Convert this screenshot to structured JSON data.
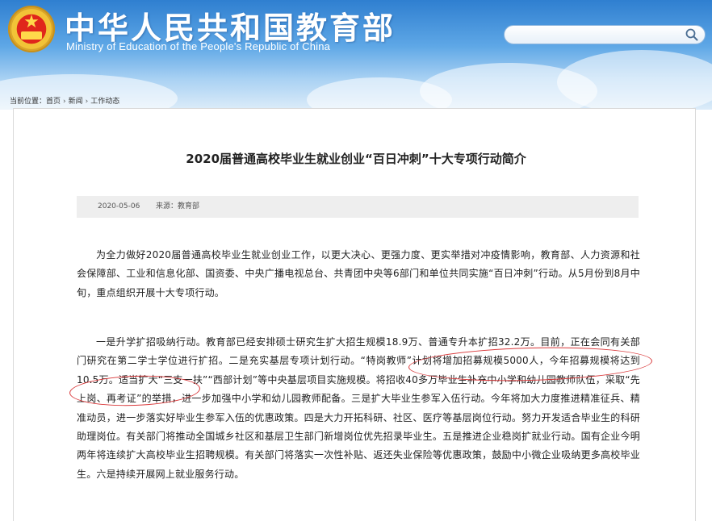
{
  "header": {
    "title": "中华人民共和国教育部",
    "subtitle": "Ministry of Education of the People's Republic of China",
    "search": {
      "value": "",
      "icon": "search-icon"
    },
    "emblem_icon": "national-emblem-icon"
  },
  "breadcrumb": {
    "prefix": "当前位置：",
    "items": [
      "首页",
      "新闻",
      "工作动态"
    ],
    "separator": "›"
  },
  "article": {
    "title": "2020届普通高校毕业生就业创业“百日冲刺”十大专项行动简介",
    "date": "2020-05-06",
    "source": "来源：教育部",
    "paragraphs": [
      "为全力做好2020届普通高校毕业生就业创业工作，以更大决心、更强力度、更实举措对冲疫情影响，教育部、人力资源和社会保障部、工业和信息化部、国资委、中央广播电视总台、共青团中央等6部门和单位共同实施“百日冲刺”行动。从5月份到8月中旬，重点组织开展十大专项行动。",
      "一是升学扩招吸纳行动。教育部已经安排硕士研究生扩大招生规模18.9万、普通专升本扩招32.2万。目前，正在会同有关部门研究在第二学士学位进行扩招。二是充实基层专项计划行动。“特岗教师”计划将增加招募规模5000人，今年招募规模将达到10.5万。适当扩大“三支一扶”“西部计划”等中央基层项目实施规模。将招收40多万毕业生补充中小学和幼儿园教师队伍，采取“先上岗、再考证”的举措，进一步加强中小学和幼儿园教师配备。三是扩大毕业生参军入伍行动。今年将加大力度推进精准征兵、精准动员，进一步落实好毕业生参军入伍的优惠政策。四是大力开拓科研、社区、医疗等基层岗位行动。努力开发适合毕业生的科研助理岗位。有关部门将推动全国城乡社区和基层卫生部门新增岗位优先招录毕业生。五是推进企业稳岗扩就业行动。国有企业今明两年将连续扩大高校毕业生招聘规模。有关部门将落实一次性补贴、返还失业保险等优惠政策，鼓励中小微企业吸纳更多高校毕业生。六是持续开展网上就业服务行动。"
    ]
  },
  "colors": {
    "header_top": "#2f7fd0",
    "header_bottom": "#dcecf9",
    "annotation_red": "#d9383a",
    "meta_bar": "#eeeeee"
  }
}
